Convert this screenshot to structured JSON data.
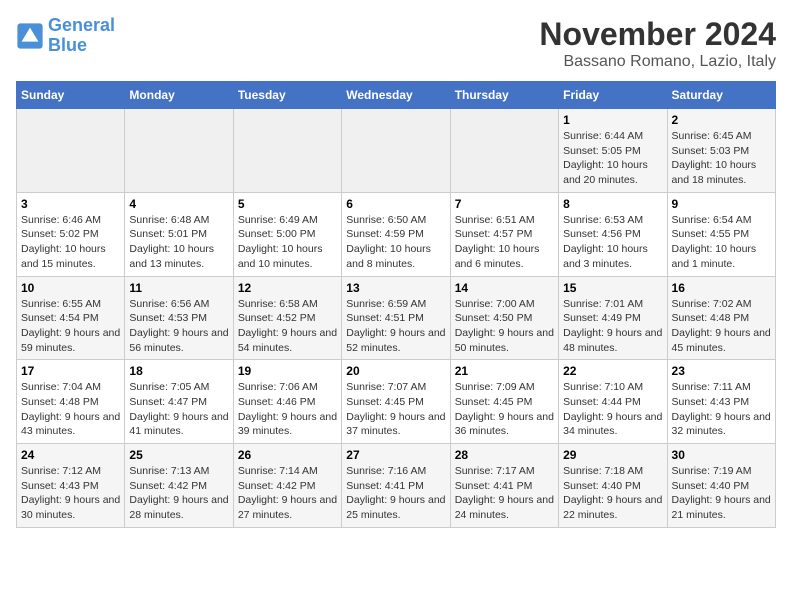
{
  "logo": {
    "line1": "General",
    "line2": "Blue"
  },
  "title": "November 2024",
  "location": "Bassano Romano, Lazio, Italy",
  "weekdays": [
    "Sunday",
    "Monday",
    "Tuesday",
    "Wednesday",
    "Thursday",
    "Friday",
    "Saturday"
  ],
  "weeks": [
    [
      {
        "day": "",
        "info": ""
      },
      {
        "day": "",
        "info": ""
      },
      {
        "day": "",
        "info": ""
      },
      {
        "day": "",
        "info": ""
      },
      {
        "day": "",
        "info": ""
      },
      {
        "day": "1",
        "info": "Sunrise: 6:44 AM\nSunset: 5:05 PM\nDaylight: 10 hours and 20 minutes."
      },
      {
        "day": "2",
        "info": "Sunrise: 6:45 AM\nSunset: 5:03 PM\nDaylight: 10 hours and 18 minutes."
      }
    ],
    [
      {
        "day": "3",
        "info": "Sunrise: 6:46 AM\nSunset: 5:02 PM\nDaylight: 10 hours and 15 minutes."
      },
      {
        "day": "4",
        "info": "Sunrise: 6:48 AM\nSunset: 5:01 PM\nDaylight: 10 hours and 13 minutes."
      },
      {
        "day": "5",
        "info": "Sunrise: 6:49 AM\nSunset: 5:00 PM\nDaylight: 10 hours and 10 minutes."
      },
      {
        "day": "6",
        "info": "Sunrise: 6:50 AM\nSunset: 4:59 PM\nDaylight: 10 hours and 8 minutes."
      },
      {
        "day": "7",
        "info": "Sunrise: 6:51 AM\nSunset: 4:57 PM\nDaylight: 10 hours and 6 minutes."
      },
      {
        "day": "8",
        "info": "Sunrise: 6:53 AM\nSunset: 4:56 PM\nDaylight: 10 hours and 3 minutes."
      },
      {
        "day": "9",
        "info": "Sunrise: 6:54 AM\nSunset: 4:55 PM\nDaylight: 10 hours and 1 minute."
      }
    ],
    [
      {
        "day": "10",
        "info": "Sunrise: 6:55 AM\nSunset: 4:54 PM\nDaylight: 9 hours and 59 minutes."
      },
      {
        "day": "11",
        "info": "Sunrise: 6:56 AM\nSunset: 4:53 PM\nDaylight: 9 hours and 56 minutes."
      },
      {
        "day": "12",
        "info": "Sunrise: 6:58 AM\nSunset: 4:52 PM\nDaylight: 9 hours and 54 minutes."
      },
      {
        "day": "13",
        "info": "Sunrise: 6:59 AM\nSunset: 4:51 PM\nDaylight: 9 hours and 52 minutes."
      },
      {
        "day": "14",
        "info": "Sunrise: 7:00 AM\nSunset: 4:50 PM\nDaylight: 9 hours and 50 minutes."
      },
      {
        "day": "15",
        "info": "Sunrise: 7:01 AM\nSunset: 4:49 PM\nDaylight: 9 hours and 48 minutes."
      },
      {
        "day": "16",
        "info": "Sunrise: 7:02 AM\nSunset: 4:48 PM\nDaylight: 9 hours and 45 minutes."
      }
    ],
    [
      {
        "day": "17",
        "info": "Sunrise: 7:04 AM\nSunset: 4:48 PM\nDaylight: 9 hours and 43 minutes."
      },
      {
        "day": "18",
        "info": "Sunrise: 7:05 AM\nSunset: 4:47 PM\nDaylight: 9 hours and 41 minutes."
      },
      {
        "day": "19",
        "info": "Sunrise: 7:06 AM\nSunset: 4:46 PM\nDaylight: 9 hours and 39 minutes."
      },
      {
        "day": "20",
        "info": "Sunrise: 7:07 AM\nSunset: 4:45 PM\nDaylight: 9 hours and 37 minutes."
      },
      {
        "day": "21",
        "info": "Sunrise: 7:09 AM\nSunset: 4:45 PM\nDaylight: 9 hours and 36 minutes."
      },
      {
        "day": "22",
        "info": "Sunrise: 7:10 AM\nSunset: 4:44 PM\nDaylight: 9 hours and 34 minutes."
      },
      {
        "day": "23",
        "info": "Sunrise: 7:11 AM\nSunset: 4:43 PM\nDaylight: 9 hours and 32 minutes."
      }
    ],
    [
      {
        "day": "24",
        "info": "Sunrise: 7:12 AM\nSunset: 4:43 PM\nDaylight: 9 hours and 30 minutes."
      },
      {
        "day": "25",
        "info": "Sunrise: 7:13 AM\nSunset: 4:42 PM\nDaylight: 9 hours and 28 minutes."
      },
      {
        "day": "26",
        "info": "Sunrise: 7:14 AM\nSunset: 4:42 PM\nDaylight: 9 hours and 27 minutes."
      },
      {
        "day": "27",
        "info": "Sunrise: 7:16 AM\nSunset: 4:41 PM\nDaylight: 9 hours and 25 minutes."
      },
      {
        "day": "28",
        "info": "Sunrise: 7:17 AM\nSunset: 4:41 PM\nDaylight: 9 hours and 24 minutes."
      },
      {
        "day": "29",
        "info": "Sunrise: 7:18 AM\nSunset: 4:40 PM\nDaylight: 9 hours and 22 minutes."
      },
      {
        "day": "30",
        "info": "Sunrise: 7:19 AM\nSunset: 4:40 PM\nDaylight: 9 hours and 21 minutes."
      }
    ]
  ]
}
